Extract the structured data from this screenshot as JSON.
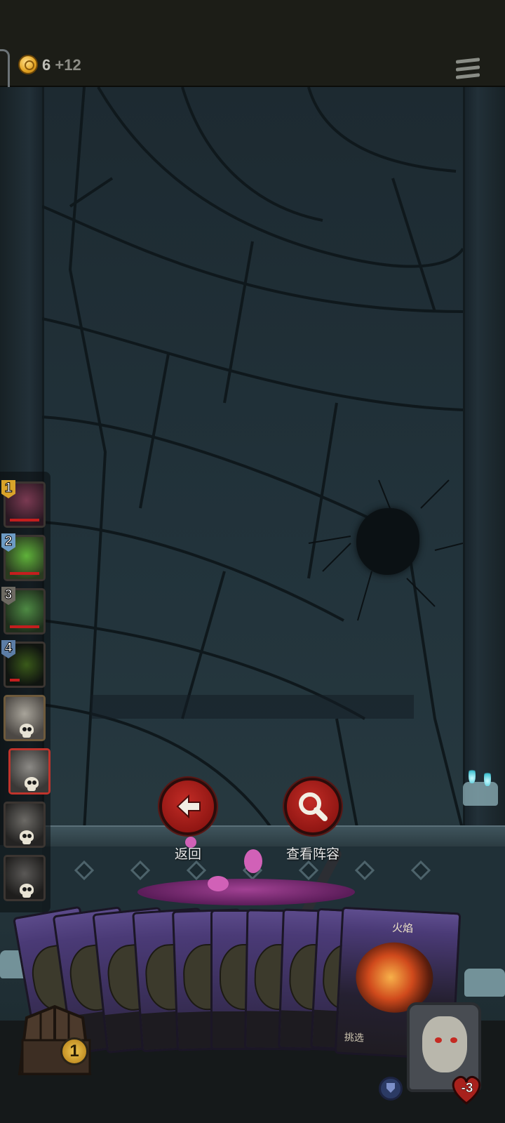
{
  "header": {
    "gold": "6",
    "gold_bonus": "+12",
    "coin_icon": "crown-coin-icon",
    "menu_icon": "hamburger-menu-icon"
  },
  "party": [
    {
      "rank": "1",
      "rank_color": "#d9a42a",
      "portrait_color": "#5a2a3a",
      "alive": true
    },
    {
      "rank": "2",
      "rank_color": "#6d9bc4",
      "portrait_color": "#3a5a2a",
      "alive": true
    },
    {
      "rank": "3",
      "rank_color": "#6d6a62",
      "portrait_color": "#2f4a30",
      "alive": true
    },
    {
      "rank": "4",
      "rank_color": "#5c7da6",
      "portrait_color": "#1a1d1a",
      "alive": true
    },
    {
      "rank": "",
      "rank_color": "",
      "portrait_color": "#6b6660",
      "alive": false
    },
    {
      "rank": "",
      "rank_color": "",
      "portrait_color": "#5a5854",
      "alive": false,
      "selected": true
    },
    {
      "rank": "",
      "rank_color": "",
      "portrait_color": "#3c3a38",
      "alive": false
    },
    {
      "rank": "",
      "rank_color": "",
      "portrait_color": "#2e2c2b",
      "alive": false
    }
  ],
  "actions": {
    "back_label": "返回",
    "view_lineup_label": "查看阵容",
    "back_icon": "arrow-left-icon",
    "view_icon": "magnifier-icon"
  },
  "hand": {
    "card_count": 9,
    "top_card_name": "火焰",
    "top_card_action": "挑选"
  },
  "hud": {
    "deck_count": "1",
    "hero_hp_change": "-3",
    "shield_icon": "shield-icon",
    "chest_icon": "treasure-chest-icon"
  },
  "colors": {
    "button_red": "#b2221d",
    "card_purple": "#4a3a76",
    "gold": "#e3a322"
  }
}
